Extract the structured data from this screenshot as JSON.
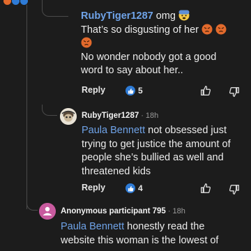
{
  "colors": {
    "background": "#1c1c1c",
    "mention": "#6fa3e8",
    "like": "#2e7bd6",
    "angry": "#e26a2c",
    "anon_avatar": "#c85a9e"
  },
  "comments": [
    {
      "author": "RubyTiger1287",
      "lines": [
        "omg",
        "That’s so disgusting of her",
        "No wonder nobody got a good",
        "word to say about her.."
      ],
      "emoji": [
        "fearful-face",
        "angry-face",
        "angry-face",
        "angry-face"
      ],
      "reply_label": "Reply",
      "like_count": "5"
    },
    {
      "author": "RubyTiger1287",
      "time": "18h",
      "mention": "Paula Bennett",
      "lines": [
        "not obsessed just",
        "trying to get justice the amount of",
        "people she’s bullied as well and",
        "threatened kids"
      ],
      "reply_label": "Reply",
      "like_count": "4"
    },
    {
      "author": "Anonymous participant 795",
      "time": "18h",
      "mention": "Paula Bennett",
      "lines": [
        "honestly read the",
        "website this woman is the lowest of"
      ]
    }
  ]
}
